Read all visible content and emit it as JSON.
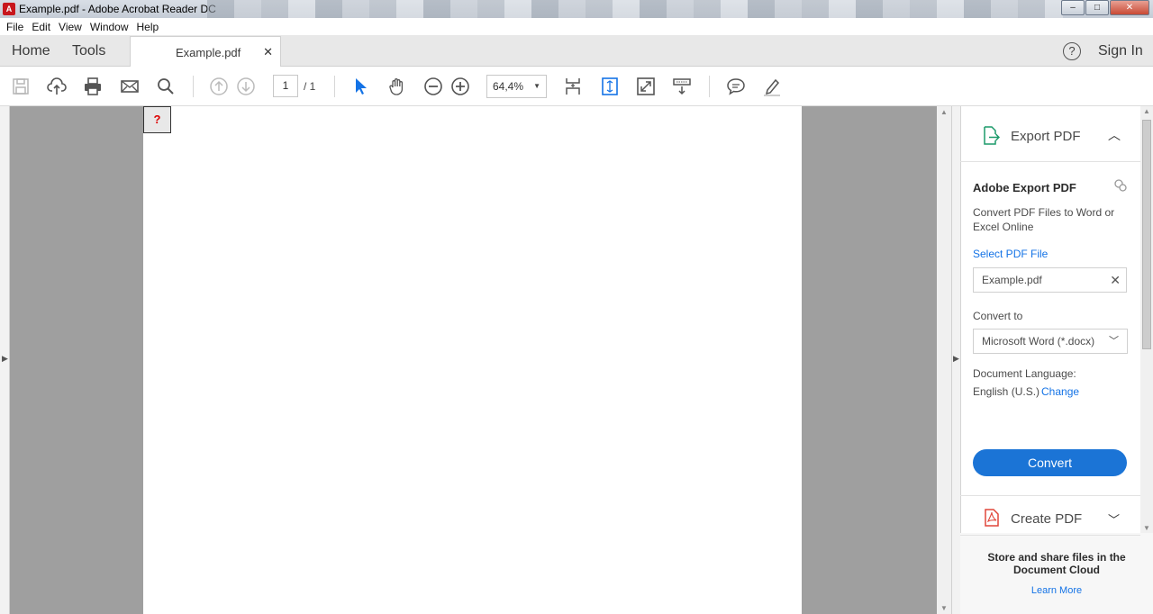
{
  "window": {
    "title": "Example.pdf - Adobe Acrobat Reader DC",
    "btn_min": "–",
    "btn_max": "□",
    "btn_close": "✕"
  },
  "menu": [
    "File",
    "Edit",
    "View",
    "Window",
    "Help"
  ],
  "tabbar": {
    "home": "Home",
    "tools": "Tools",
    "doc_tab": "Example.pdf",
    "close": "✕",
    "help": "?",
    "sign_in": "Sign In"
  },
  "toolbar": {
    "page_current": "1",
    "page_total": "/ 1",
    "zoom": "64,4%"
  },
  "document": {
    "missing_image": "?"
  },
  "export_pdf": {
    "header": "Export PDF",
    "title": "Adobe Export PDF",
    "description": "Convert PDF Files to Word or Excel Online",
    "select_file_label": "Select PDF File",
    "file_name": "Example.pdf",
    "convert_to_label": "Convert to",
    "format": "Microsoft Word (*.docx)",
    "language_label": "Document Language:",
    "language_value": "English (U.S.)",
    "change_link": "Change",
    "convert_button": "Convert"
  },
  "create_pdf": {
    "header": "Create PDF"
  },
  "cloud": {
    "text": "Store and share files in the Document Cloud",
    "learn_more": "Learn More"
  },
  "colors": {
    "accent": "#1473e6",
    "button": "#1b74d6",
    "doc_bg": "#9f9f9f"
  }
}
